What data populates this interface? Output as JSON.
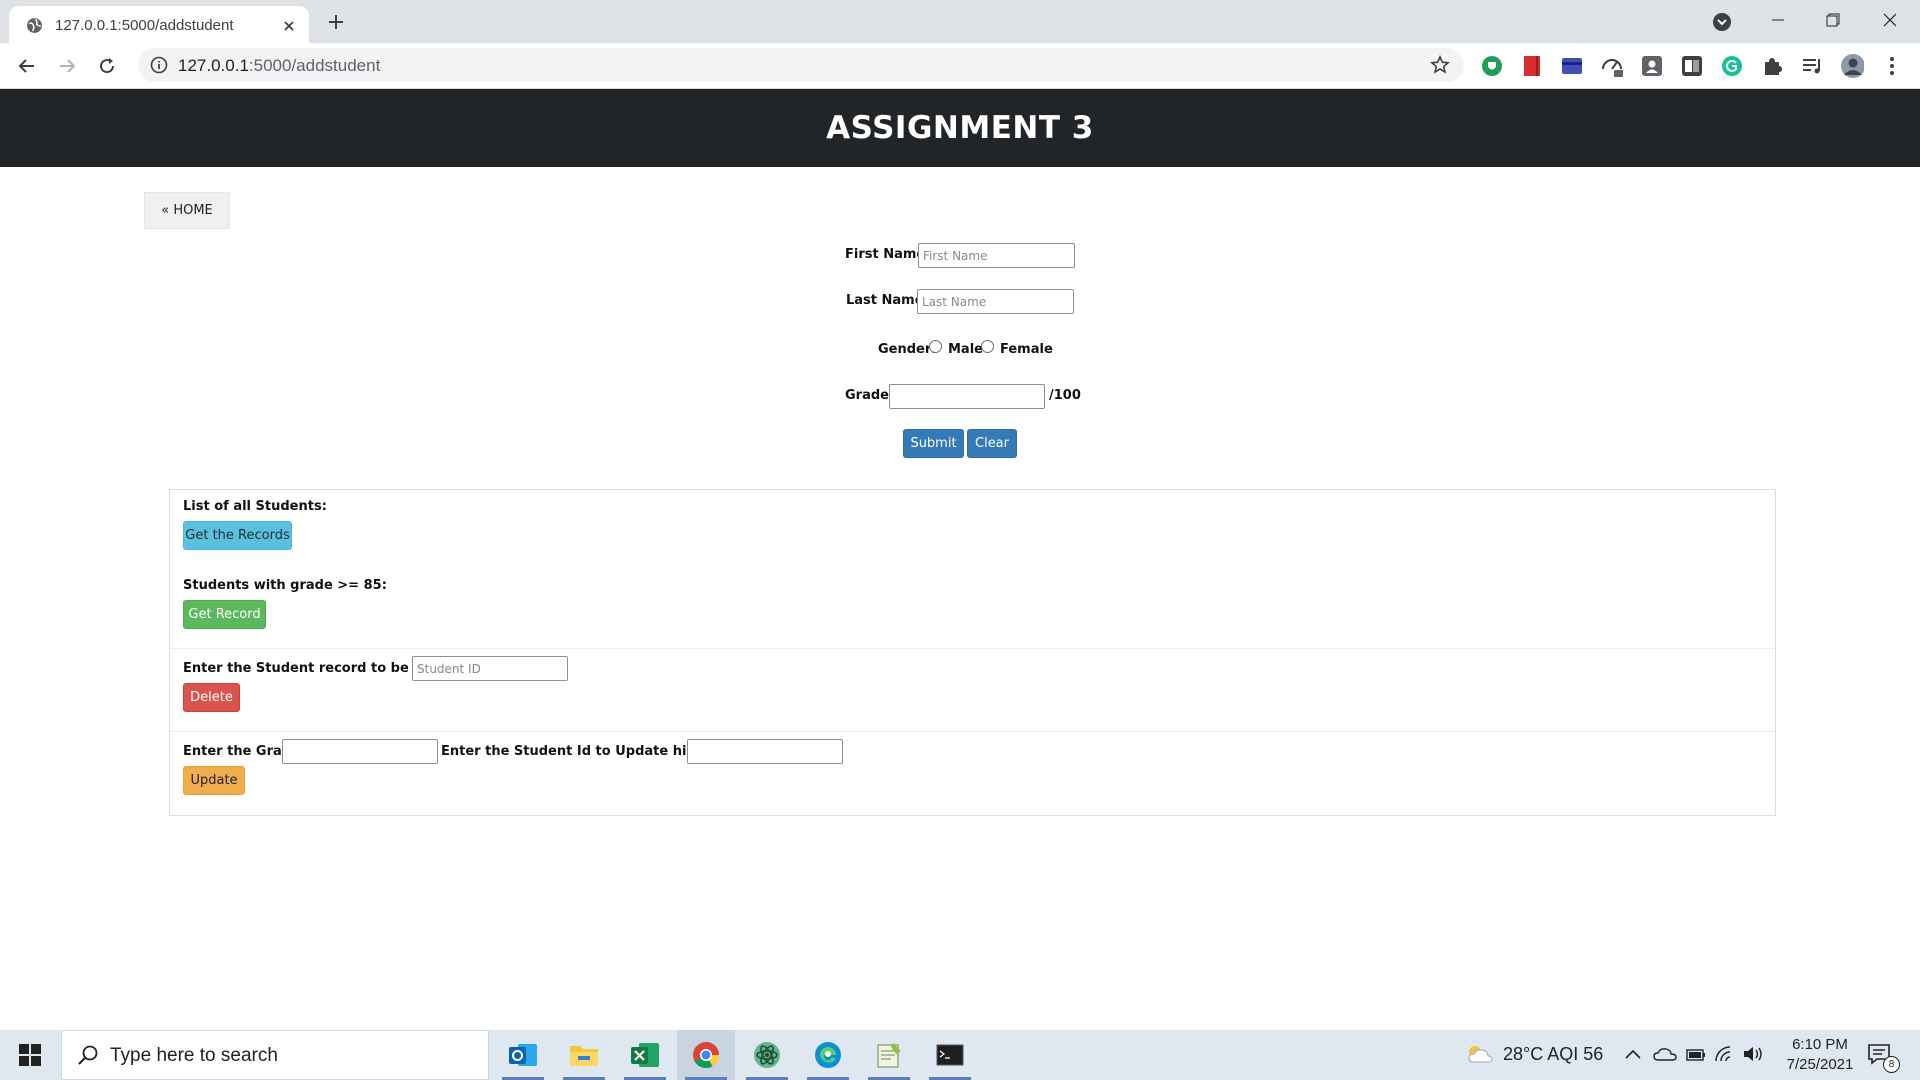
{
  "browser": {
    "tab_title": "127.0.0.1:5000/addstudent",
    "url_host": "127.0.0.1",
    "url_path": ":5000/addstudent"
  },
  "page": {
    "header_title": "ASSIGNMENT 3",
    "home_label": "« HOME",
    "form": {
      "first_name_label": "First Name:",
      "first_name_placeholder": "First Name",
      "last_name_label": "Last Name:",
      "last_name_placeholder": "Last Name",
      "gender_label": "Gender:",
      "gender_options": [
        "Male",
        "Female"
      ],
      "grade_label": "Grade:",
      "grade_suffix": "/100",
      "submit_label": "Submit",
      "clear_label": "Clear"
    },
    "records": {
      "list_all_label": "List of all Students:",
      "get_records_label": "Get the Records",
      "high_grade_label": "Students with grade >= 85:",
      "get_record_label": "Get Record",
      "delete_prompt": "Enter the Student record to be deleted",
      "delete_placeholder": "Student ID",
      "delete_label": "Delete",
      "update_grade_label": "Enter the Grade:",
      "update_id_label": "Enter the Student Id to Update his Grade:",
      "update_label": "Update"
    }
  },
  "taskbar": {
    "search_placeholder": "Type here to search",
    "weather": "28°C  AQI 56",
    "time": "6:10 PM",
    "date": "7/25/2021",
    "notifications": "8"
  },
  "colors": {
    "header_bg": "#222528",
    "primary": "#337ab7",
    "info": "#5bc0de",
    "success": "#5cb85c",
    "danger": "#d9534f",
    "warning": "#f0ad4e"
  }
}
